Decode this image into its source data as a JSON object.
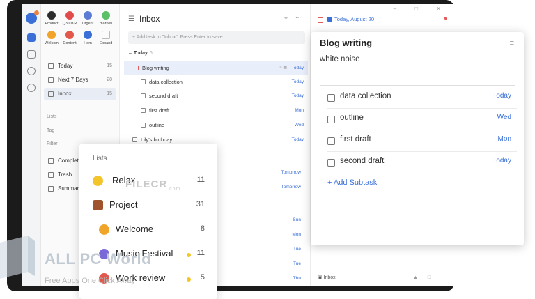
{
  "apps": [
    {
      "label": "Product",
      "color": "#2c2c2c"
    },
    {
      "label": "Q3 OKR",
      "color": "#e24b4b"
    },
    {
      "label": "Urgent",
      "color": "#5b7bd5"
    },
    {
      "label": "marketi",
      "color": "#5bbf6a"
    },
    {
      "label": "Welcom",
      "color": "#f0a52a"
    },
    {
      "label": "Content",
      "color": "#e2584b"
    },
    {
      "label": "Hom",
      "color": "#3a6fd8"
    },
    {
      "label": "Expand",
      "color": "#cccccc"
    }
  ],
  "sidebar": {
    "nav": [
      {
        "label": "Today",
        "count": "15"
      },
      {
        "label": "Next 7 Days",
        "count": "28"
      },
      {
        "label": "Inbox",
        "count": "15"
      }
    ],
    "sections": [
      "Lists",
      "Tag",
      "Filter"
    ],
    "bottom": [
      "Completed",
      "Trash",
      "Summary"
    ]
  },
  "list": {
    "title": "Inbox",
    "add_placeholder": "+ Add task to \"Inbox\". Press Enter to save.",
    "group_label": "Today",
    "group_count": "6",
    "rows": [
      {
        "title": "Blog writing",
        "date": "Today"
      },
      {
        "title": "data collection",
        "date": "Today"
      },
      {
        "title": "second draft",
        "date": "Today"
      },
      {
        "title": "first draft",
        "date": "Mon"
      },
      {
        "title": "outline",
        "date": "Wed"
      },
      {
        "title": "Lily's birthday",
        "date": "Today"
      }
    ],
    "extra_dates": [
      "Tomorrow",
      "Tomorrow",
      "Sun",
      "Mon",
      "Tue",
      "Tue",
      "Thu"
    ]
  },
  "detail": {
    "date": "Today, August 20",
    "footer_list": "Inbox"
  },
  "card": {
    "title": "Blog writing",
    "note": "white noise",
    "subtasks": [
      {
        "title": "data collection",
        "date": "Today"
      },
      {
        "title": "outline",
        "date": "Wed"
      },
      {
        "title": "first draft",
        "date": "Mon"
      },
      {
        "title": "second draft",
        "date": "Today"
      }
    ],
    "add_subtask": "+ Add Subtask"
  },
  "popup": {
    "title": "Lists",
    "items": [
      {
        "name": "Relax",
        "count": "11",
        "dot": false,
        "emoji_color": "#f3c52a"
      },
      {
        "name": "Project",
        "count": "31",
        "dot": false,
        "emoji_color": "#a0522d"
      },
      {
        "name": "Welcome",
        "count": "8",
        "dot": false,
        "emoji_color": "#f0a52a"
      },
      {
        "name": "Music Festival",
        "count": "11",
        "dot": true,
        "emoji_color": "#7a6ad8"
      },
      {
        "name": "Work review",
        "count": "5",
        "dot": true,
        "emoji_color": "#e2584b"
      }
    ]
  },
  "watermark": {
    "filecr": "FILECR",
    "filecr_sub": ".com",
    "brand": "ALL PC World",
    "tagline": "Free Apps One Click Away"
  }
}
